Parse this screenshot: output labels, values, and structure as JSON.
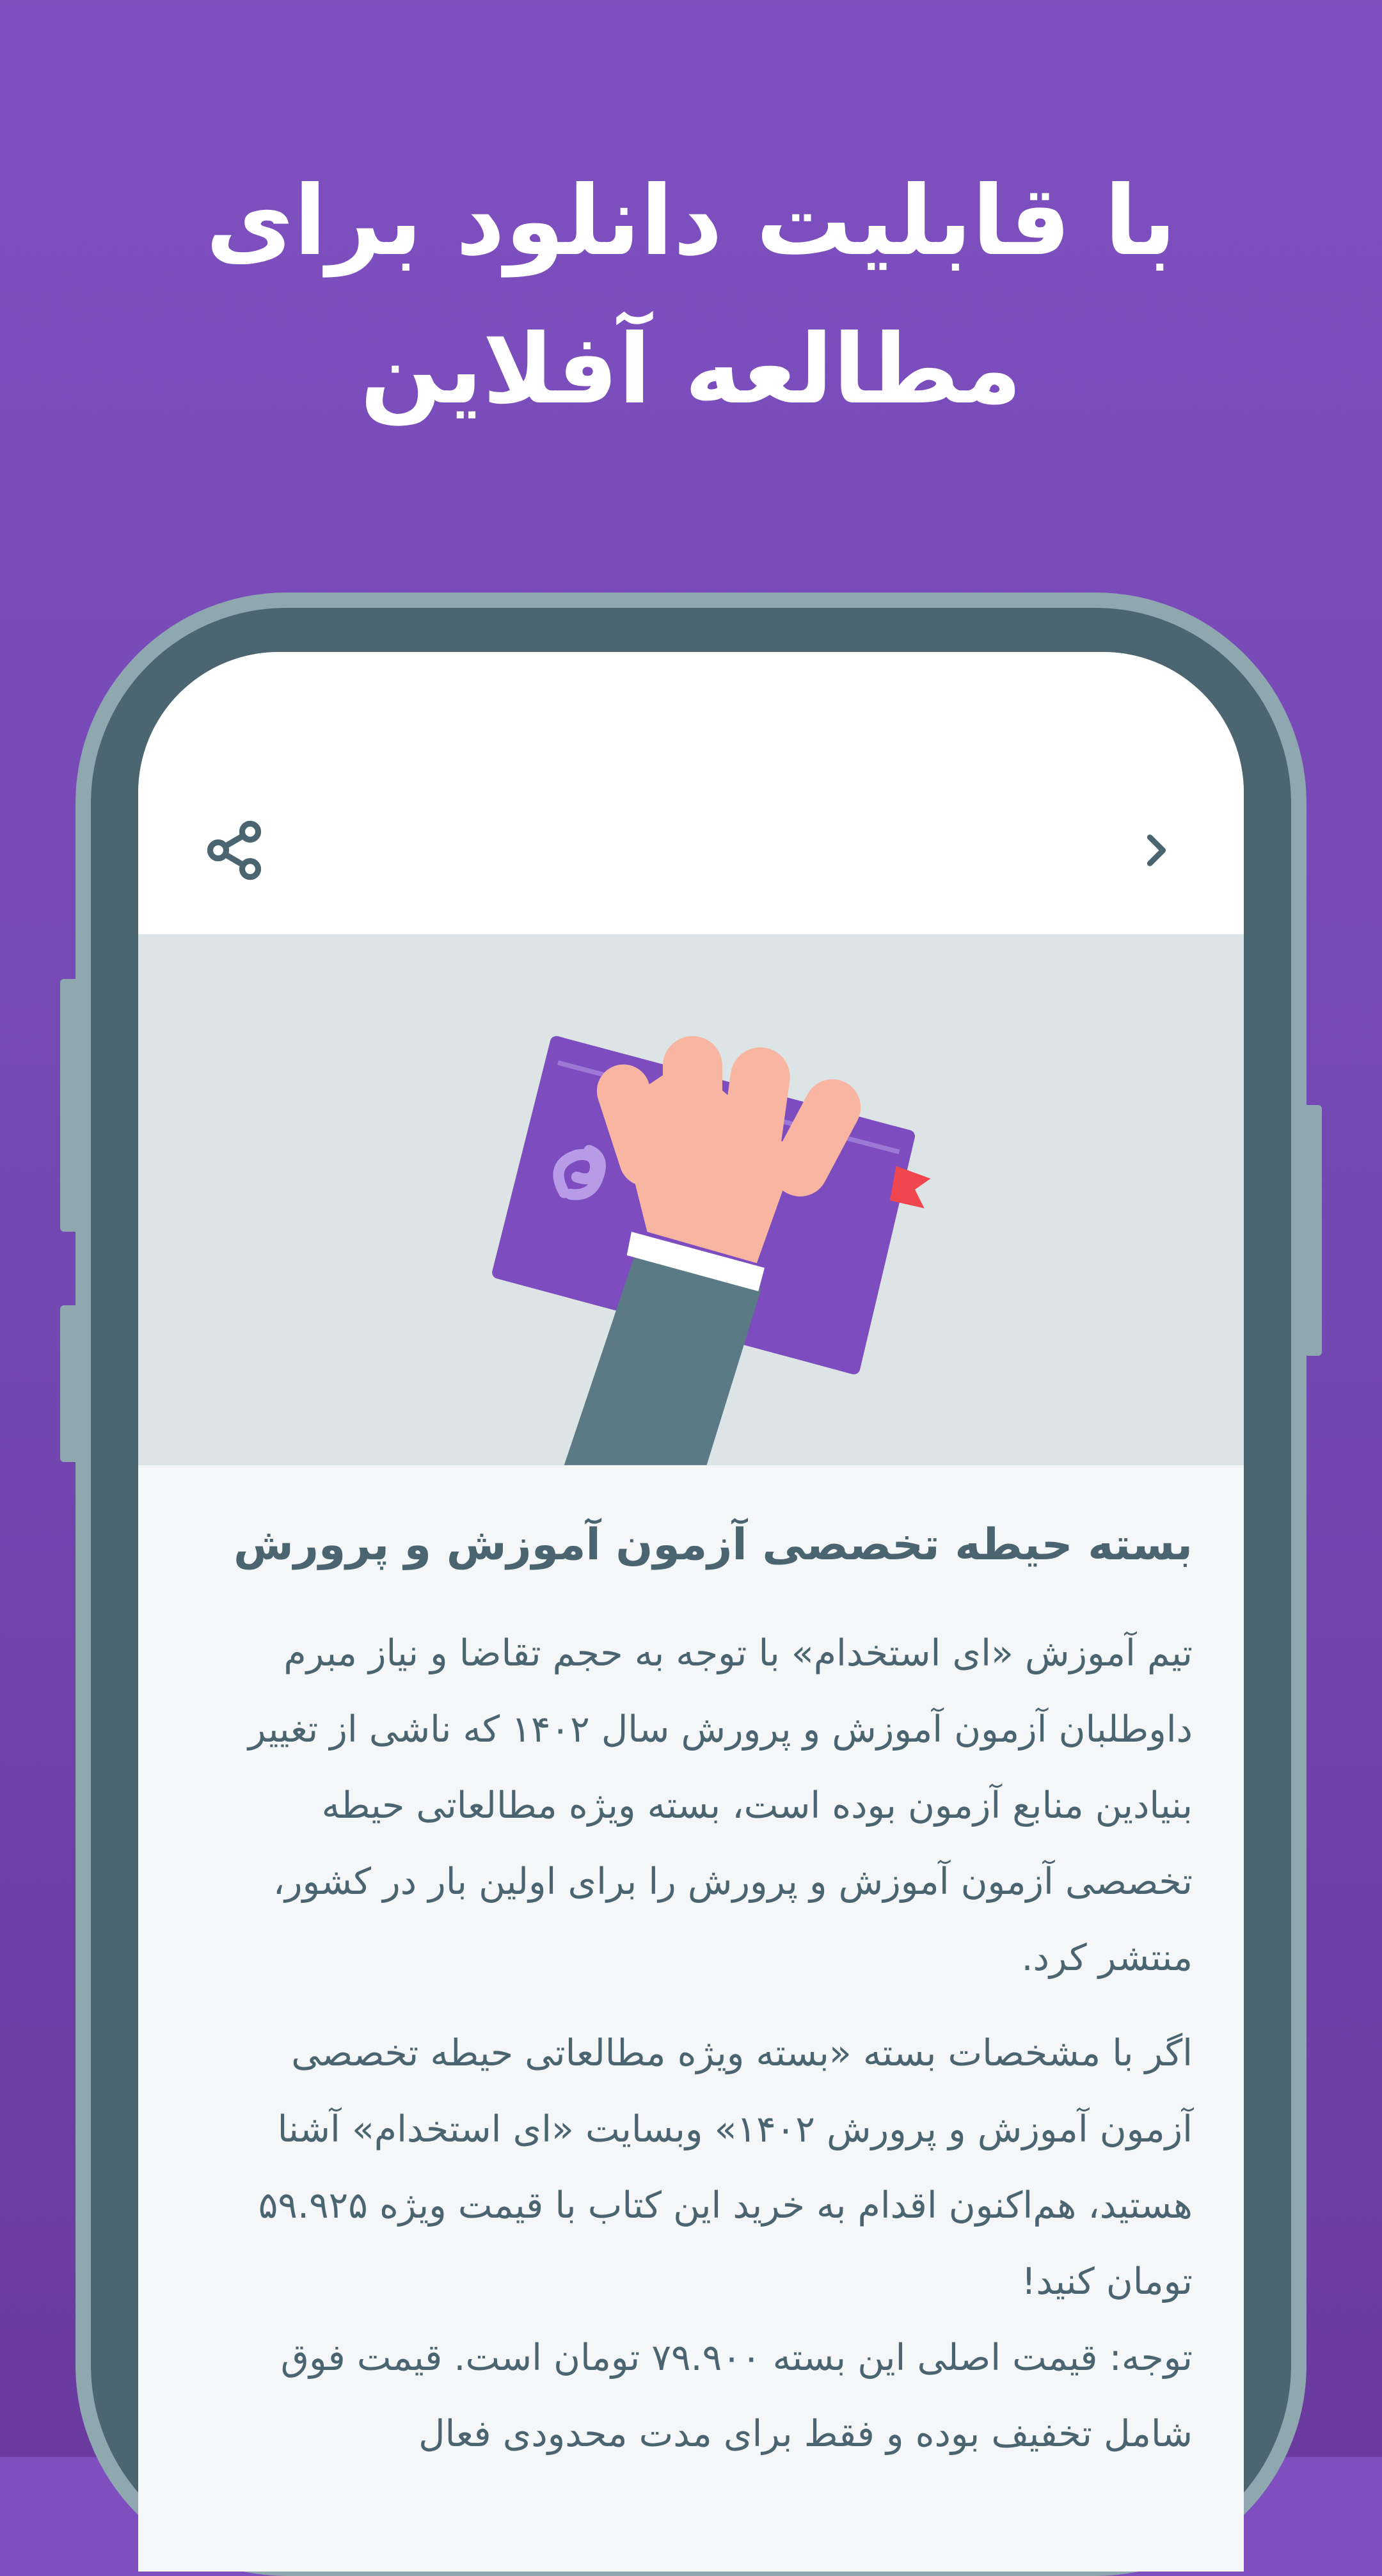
{
  "headline": {
    "line1": "با قابلیت دانلود برای",
    "line2": "مطالعه آفلاین"
  },
  "appbar": {
    "share_icon": "share-icon",
    "back_icon": "chevron-right-icon"
  },
  "hero": {
    "illustration": "hand-holding-book"
  },
  "article": {
    "title": "بسته حیطه تخصصی آزمون آموزش و پرورش",
    "paragraphs": [
      "تیم آموزش «ای استخدام» با توجه به حجم تقاضا و نیاز مبرم داوطلبان آزمون آموزش و پرورش سال ۱۴۰۲ که ناشی از تغییر بنیادین منابع آزمون بوده است، بسته ویژه مطالعاتی حیطه تخصصی آزمون آموزش و پرورش را برای اولین بار در کشور، منتشر کرد.",
      "اگر با مشخصات بسته «بسته ویژه مطالعاتی حیطه تخصصی آزمون آموزش و پرورش ۱۴۰۲» وبسایت «ای استخدام» آشنا هستید، هم‌اکنون اقدام به خرید این کتاب با قیمت ویژه ۵۹.۹۲۵ تومان کنید!",
      "توجه: قیمت اصلی این بسته ۷۹.۹۰۰ تومان است. قیمت فوق شامل تخفیف بوده و فقط برای مدت محدودی فعال"
    ]
  },
  "colors": {
    "background": "#7f4fc0",
    "frame": "#4b6670",
    "frame_border": "#8fa8b0",
    "text": "#4a6470",
    "book": "#7d4cbf",
    "hand": "#f8b6a2",
    "ribbon": "#f0474f"
  }
}
